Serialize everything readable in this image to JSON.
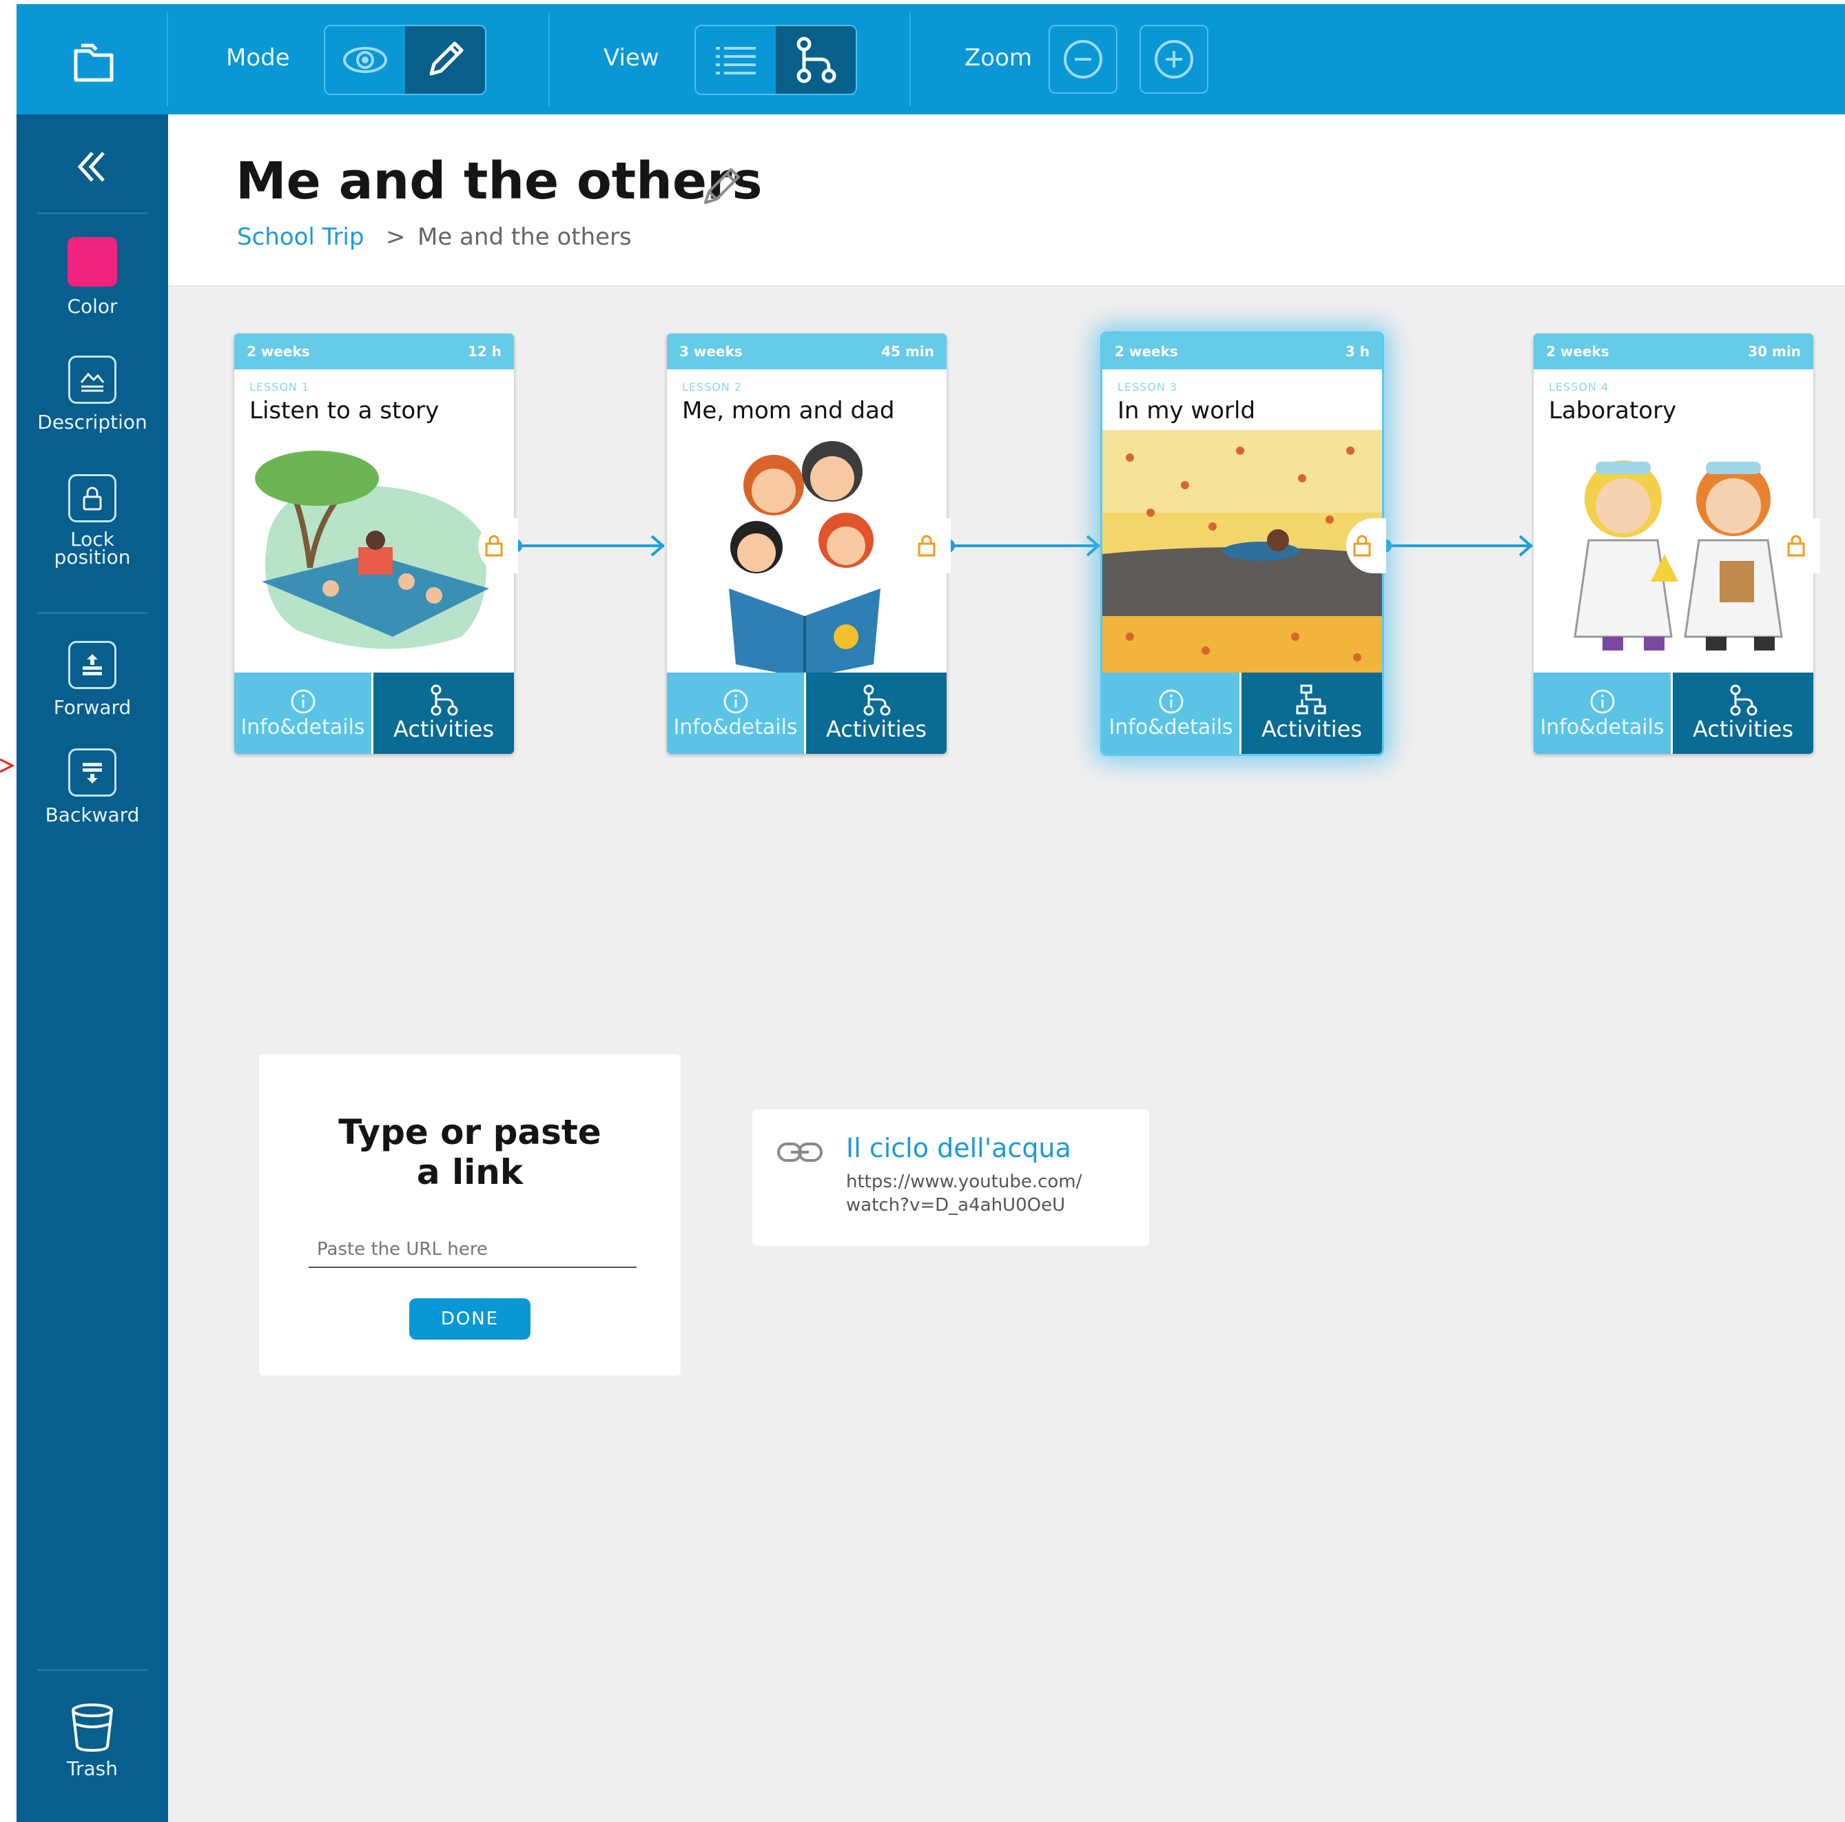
{
  "toolbar": {
    "mode_label": "Mode",
    "view_label": "View",
    "zoom_label": "Zoom",
    "mode_options": [
      "eye-icon",
      "pencil-icon"
    ],
    "mode_selected": "edit",
    "view_options": [
      "list-icon",
      "flow-icon"
    ],
    "view_selected": "flow",
    "accent_color": "#0a97d6"
  },
  "sidebar": {
    "collapse_icon": "double-chevron-left-icon",
    "color_label": "Color",
    "color_value": "#f0237f",
    "description_label": "Description",
    "lock_label": "Lock\nposition",
    "forward_label": "Forward",
    "backward_label": "Backward",
    "trash_label": "Trash"
  },
  "header": {
    "title": "Me and the others",
    "breadcrumb_root": "School Trip",
    "breadcrumb_sep": ">",
    "breadcrumb_current": "Me and the others"
  },
  "lessons": [
    {
      "duration": "2 weeks",
      "time": "12 h",
      "lesson": "LESSON 1",
      "title": "Listen to a story",
      "info_label": "Info&details",
      "activities_label": "Activities"
    },
    {
      "duration": "3 weeks",
      "time": "45 min",
      "lesson": "LESSON 2",
      "title": "Me, mom and dad",
      "info_label": "Info&details",
      "activities_label": "Activities"
    },
    {
      "duration": "2 weeks",
      "time": "3 h",
      "lesson": "LESSON 3",
      "title": "In my world",
      "info_label": "Info&details",
      "activities_label": "Activities"
    },
    {
      "duration": "2 weeks",
      "time": "30 min",
      "lesson": "LESSON 4",
      "title": "Laboratory",
      "info_label": "Info&details",
      "activities_label": "Activities"
    }
  ],
  "link_dialog": {
    "heading": "Type or paste\na link",
    "url_placeholder": "Paste the URL here",
    "done_label": "DONE"
  },
  "link_result": {
    "title": "Il ciclo dell'acqua",
    "url": "https://www.youtube.com/\nwatch?v=D_a4ahU0OeU"
  }
}
